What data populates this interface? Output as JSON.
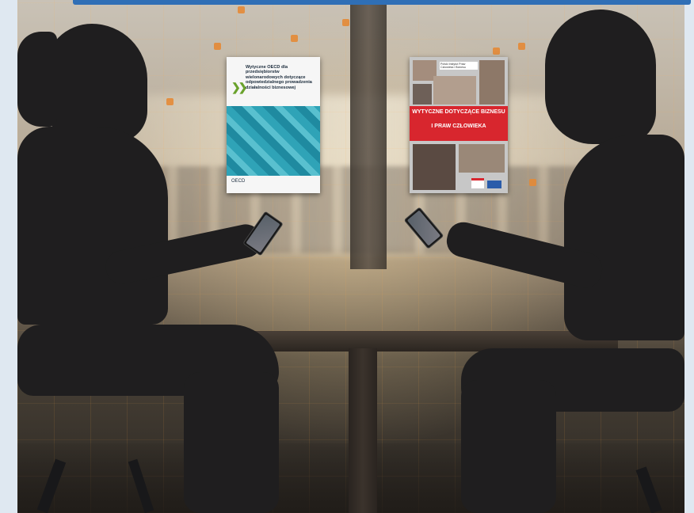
{
  "scene": {
    "description_colors": {
      "accent_bar": "#2f6fb6",
      "glow": "#e48a36",
      "silhouette": "#1f1e1f"
    }
  },
  "book_left": {
    "title": "Wytyczne OECD dla przedsiębiorstw wielonarodowych dotyczące odpowiedzialnego prowadzenia działalności biznesowej",
    "publisher": "OECD"
  },
  "book_right": {
    "header": "Polski Instytut Praw Człowieka i Biznesu",
    "title_line1": "WYTYCZNE DOTYCZĄCE BIZNESU",
    "title_line2": "I PRAW CZŁOWIEKA"
  }
}
